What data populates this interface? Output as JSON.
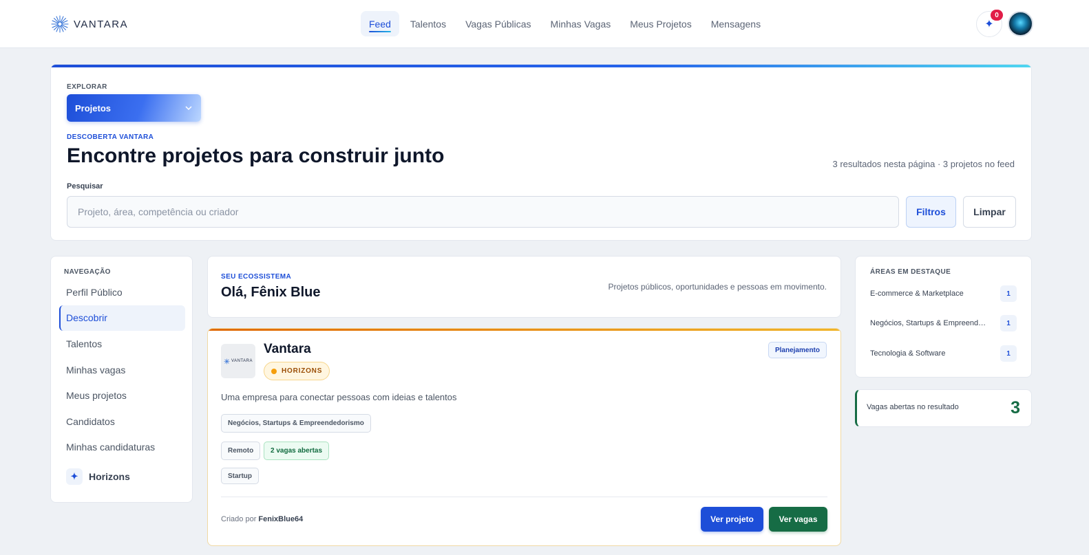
{
  "header": {
    "logo_text": "VANTARA",
    "nav": [
      {
        "label": "Feed"
      },
      {
        "label": "Talentos"
      },
      {
        "label": "Vagas Públicas"
      },
      {
        "label": "Minhas Vagas"
      },
      {
        "label": "Meus Projetos"
      },
      {
        "label": "Mensagens"
      }
    ],
    "active_nav": "Feed",
    "notification_count": "0",
    "notification_icon": "sparkle-icon",
    "avatar_icon": "user-avatar"
  },
  "hero": {
    "explore_label": "EXPLORAR",
    "explore_selected": "Projetos",
    "discovery_label": "DESCOBERTA VANTARA",
    "title": "Encontre projetos para construir junto",
    "results_text": "3 resultados nesta página · 3 projetos no feed",
    "search_label": "Pesquisar",
    "search_placeholder": "Projeto, área, competência ou criador",
    "search_value": "",
    "filters_label": "Filtros",
    "clear_label": "Limpar"
  },
  "sidebar": {
    "title": "NAVEGAÇÃO",
    "items": [
      {
        "label": "Perfil Público"
      },
      {
        "label": "Descobrir"
      },
      {
        "label": "Talentos"
      },
      {
        "label": "Minhas vagas"
      },
      {
        "label": "Meus projetos"
      },
      {
        "label": "Candidatos"
      },
      {
        "label": "Minhas candidaturas"
      }
    ],
    "active_item": "Descobrir",
    "horizons_label": "Horizons",
    "horizons_icon": "sparkle-icon"
  },
  "welcome": {
    "eyebrow": "SEU ECOSSISTEMA",
    "title": "Olá, Fênix Blue",
    "subtitle": "Projetos públicos, oportunidades e pessoas em movimento."
  },
  "project": {
    "logo_text": "VANTARA",
    "title": "Vantara",
    "program_badge": "HORIZONS",
    "status": "Planejamento",
    "description": "Uma empresa para conectar pessoas com ideias e talentos",
    "category": "Negócios, Startups & Empreendedorismo",
    "mode": "Remoto",
    "open_jobs": "2 vagas abertas",
    "stage": "Startup",
    "created_by_prefix": "Criado por",
    "creator": "FenixBlue64",
    "view_project_label": "Ver projeto",
    "view_jobs_label": "Ver vagas"
  },
  "areas": {
    "title": "ÁREAS EM DESTAQUE",
    "items": [
      {
        "name": "E-commerce & Marketplace",
        "count": "1"
      },
      {
        "name": "Negócios, Startups & Empreendedorismo",
        "count": "1"
      },
      {
        "name": "Tecnologia & Software",
        "count": "1"
      }
    ]
  },
  "open_jobs_summary": {
    "label": "Vagas abertas no resultado",
    "value": "3"
  },
  "colors": {
    "accent": "#1d4ed8",
    "success": "#166c45",
    "warning": "#f59e0b",
    "alert": "#e11d48"
  }
}
